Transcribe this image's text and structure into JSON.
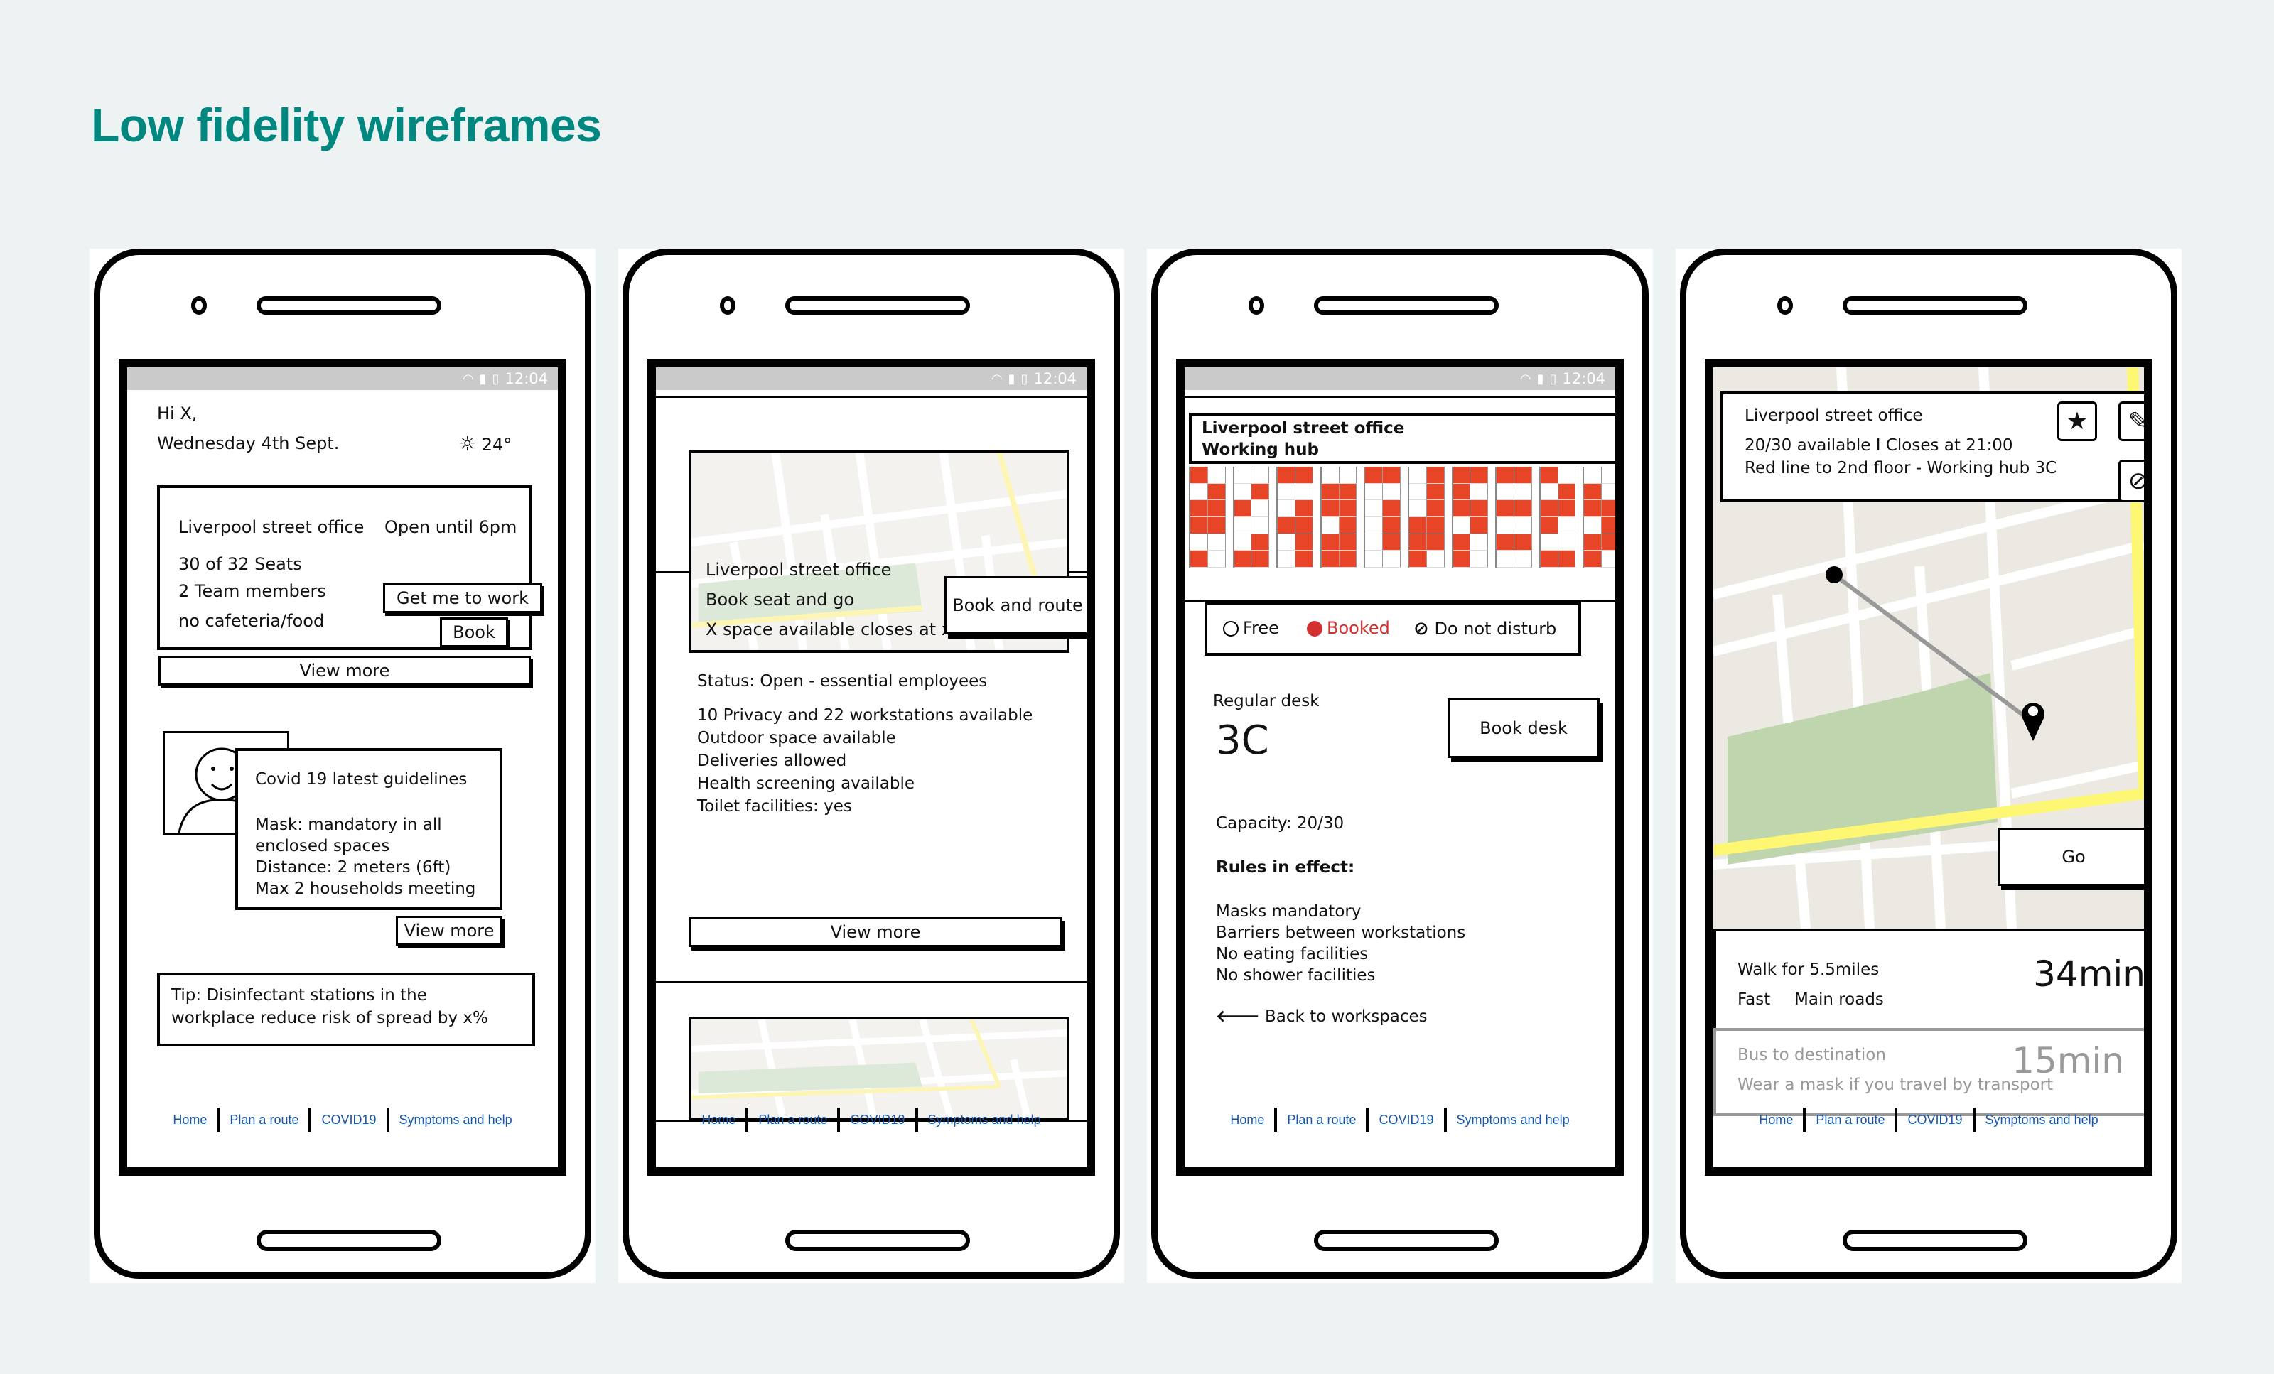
{
  "page": {
    "title": "Low fidelity wireframes",
    "accent_color": "#00877f",
    "background_color": "#edf3f3"
  },
  "status_bar": {
    "time": "12:04",
    "icons": [
      "wifi-icon",
      "signal-icon",
      "battery-icon"
    ]
  },
  "footer_links": [
    "Home",
    "Plan a route",
    "COVID19",
    "Symptoms and help"
  ],
  "screen1": {
    "greeting": "Hi X,",
    "date": "Wednesday 4th Sept.",
    "weather": {
      "icon": "sun-icon",
      "temperature": "24°"
    },
    "office_card": {
      "name": "Liverpool street office",
      "hours": "Open until 6pm",
      "seats": "30 of 32 Seats",
      "team": "2 Team members",
      "food": "no cafeteria/food",
      "get_me_to_work_label": "Get me to work",
      "book_label": "Book"
    },
    "view_more_label": "View more",
    "covid_card": {
      "title": "Covid 19 latest guidelines",
      "lines": [
        "Mask: mandatory in all",
        "enclosed spaces",
        "Distance: 2 meters (6ft)",
        "Max 2 households meeting"
      ],
      "view_more_label": "View more"
    },
    "tip": {
      "line1": "Tip: Disinfectant stations in the",
      "line2": "workplace reduce risk of spread by x%"
    }
  },
  "screen2": {
    "map_card": {
      "name": "Liverpool street office",
      "subtitle": "Book seat and go",
      "availability": "X space available closes at x",
      "book_and_route_label": "Book and route"
    },
    "status": "Status: Open - essential employees",
    "features": [
      "10 Privacy and 22 workstations available",
      "Outdoor space available",
      "Deliveries allowed",
      "Health screening available",
      "Toilet facilities: yes"
    ],
    "view_more_label": "View more"
  },
  "screen3": {
    "header": {
      "line1": "Liverpool street office",
      "line2": "Working hub"
    },
    "booking_colors": {
      "booked": "#e84427",
      "free": "#ffffff"
    },
    "desk_grid": [
      [
        "L",
        "R",
        "LR",
        "LR",
        "",
        "L"
      ],
      [
        "",
        "R",
        "L",
        "",
        "R",
        "LR"
      ],
      [
        "LR",
        "",
        "R",
        "LR",
        "R",
        "R"
      ],
      [
        "",
        "LR",
        "LR",
        "R",
        "LR",
        "LR"
      ],
      [
        "LR",
        "",
        "R",
        "R",
        "R",
        ""
      ],
      [
        "R",
        "R",
        "R",
        "LR",
        "LR",
        "L"
      ],
      [
        "LR",
        "L",
        "LR",
        "R",
        "L",
        "L"
      ],
      [
        "LR",
        "",
        "LR",
        "",
        "LR",
        ""
      ],
      [
        "L",
        "R",
        "LR",
        "L",
        "",
        "LR"
      ],
      [
        "",
        "L",
        "LR",
        "R",
        "LR",
        "L"
      ]
    ],
    "legend": [
      {
        "label": "Free",
        "icon": "free-circle-icon",
        "color": "#111111"
      },
      {
        "label": "Booked",
        "icon": "booked-dot-icon",
        "color": "#d32f2f"
      },
      {
        "label": "Do not disturb",
        "icon": "do-not-disturb-icon",
        "color": "#111111"
      }
    ],
    "desk_type": "Regular desk",
    "desk_id": "3C",
    "book_desk_label": "Book desk",
    "capacity": "Capacity: 20/30",
    "rules_title": "Rules in effect:",
    "rules": [
      "Masks mandatory",
      "Barriers between workstations",
      "No eating facilities",
      "No shower facilities"
    ],
    "back_label": "Back to workspaces"
  },
  "screen4": {
    "info_card": {
      "name": "Liverpool street office",
      "availability": "20/30 available I Closes at 21:00",
      "directions": "Red line to 2nd floor - Working hub 3C"
    },
    "go_label": "Go",
    "walk_option": {
      "title": "Walk for 5.5miles",
      "tag1": "Fast",
      "tag2": "Main roads",
      "duration": "34min"
    },
    "bus_option": {
      "title": "Bus to destination",
      "note": "Wear a mask if you travel by transport",
      "duration": "15min"
    }
  }
}
